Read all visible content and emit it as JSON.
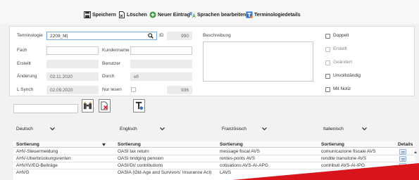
{
  "toolbar": {
    "save": "Speichern",
    "delete": "Löschen",
    "new_entry": "Neuer Eintrag",
    "edit_languages": "Sprachen bearbeiten",
    "terminology_details": "Terminologiedetails"
  },
  "form": {
    "terminologie_label": "Terminologie",
    "terminologie_value": "2209_M|",
    "id_label": "ID",
    "id_value": "990",
    "fach_label": "Fach",
    "fach_value": "",
    "kundenname_label": "Kundenname",
    "kundenname_value": "",
    "erstellt_label": "Erstellt",
    "erstellt_value": "",
    "benutzer_label": "Benutzer",
    "benutzer_value": "",
    "aenderung_label": "Änderung",
    "aenderung_value": "02.11.2020",
    "durch_label": "Durch",
    "durch_value": "efi",
    "lsynch_label": "L Synch",
    "lsynch_value": "02.09.2020",
    "nur_lesen_label": "Nur lesen",
    "count_value": "936",
    "beschreibung_label": "Beschreibung"
  },
  "checkboxes": {
    "doppelt": "Doppelt",
    "erstellt": "Erstellt",
    "geaendert": "Geändert",
    "unvollstaendig": "Unvollständig",
    "mit_notiz": "Mit Notiz"
  },
  "languages": {
    "lang1": "Deutsch",
    "lang2": "Englisch",
    "lang3": "Französisch",
    "lang4": "Italienisch"
  },
  "grid": {
    "headers": [
      "Sortierung",
      "Sortierung",
      "Sortierung",
      "Sortierung",
      "Details"
    ],
    "rows": [
      [
        "AHV-Steuermeldung",
        "OASI tax return",
        "message fiscal AVS",
        "comunicazione fiscale AVS"
      ],
      [
        "AHV-Überbrückungsrenten",
        "OASI bridging pension",
        "rentes-ponts AVS",
        "rendite transitorie AVS"
      ],
      [
        "AHV/IV/EO-Beiträge",
        "OASI/DI/ contributions",
        "cotisations AVS-AI-APG",
        "contributi AVS-AI-IPG"
      ],
      [
        "AHVG",
        "OASIA (Old-Age and Survivors' Insurance Act)",
        "LAVS",
        ""
      ]
    ]
  },
  "colors": {
    "accent_blue": "#2f6fc4",
    "green": "#3a9a3a",
    "red_corner": "#d8151c"
  }
}
